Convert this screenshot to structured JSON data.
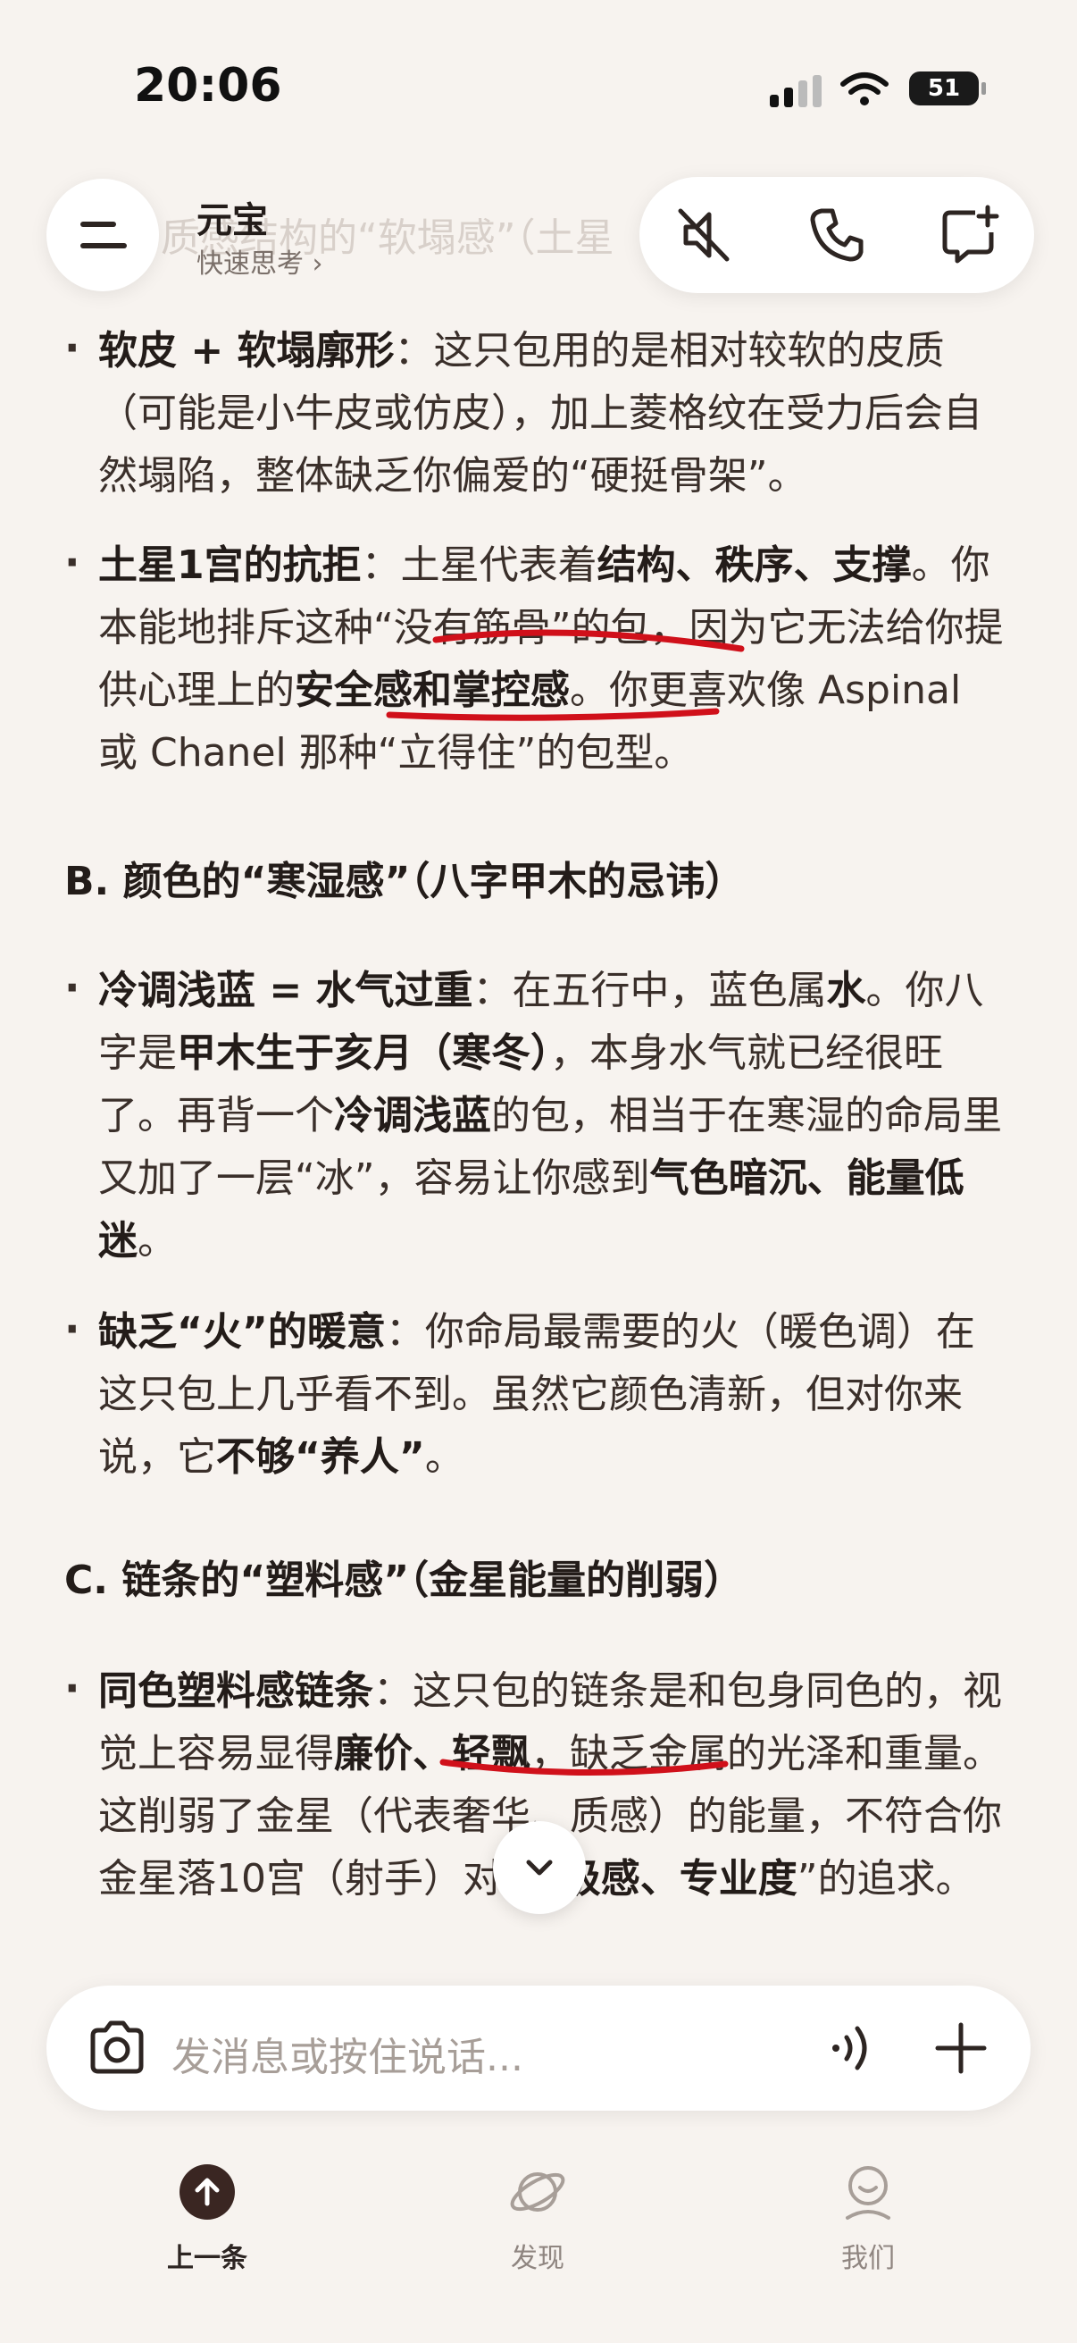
{
  "status": {
    "time": "20:06",
    "battery": "51"
  },
  "header": {
    "title": "元宝",
    "subtitle": "快速思考 ›",
    "faded_title": "质感结构的“软塌感”（土星",
    "menu_icon": "menu-icon",
    "actions": [
      "mute-speaker-icon",
      "phone-icon",
      "new-chat-icon"
    ]
  },
  "content": {
    "p1": {
      "bold": "软皮 + 软塌廓形",
      "text": "：这只包用的是相对较软的皮质（可能是小牛皮或仿皮），加上菱格纹在受力后会自然塌陷，整体缺乏你偏爱的“硬挺骨架”。"
    },
    "p2": {
      "bold": "土星1宫的抗拒",
      "t1": "：土星代表着",
      "b2": "结构、秩序、支撑",
      "t2": "。你本能地排斥这种“没有筋骨”的包，因为它无法给你提供心理上的",
      "b3": "安全感和掌控感",
      "t3": "。你更喜欢像 Aspinal 或 Chanel 那种“立得住”的包型。"
    },
    "heading_b": "B. 颜色的“寒湿感”（八字甲木的忌讳）",
    "p3": {
      "bold": "冷调浅蓝 = 水气过重",
      "t1": "：在五行中，蓝色属",
      "b2": "水",
      "t2": "。你八字是",
      "b3": "甲木生于亥月（寒冬）",
      "t3": "，本身水气就已经很旺了。再背一个",
      "b4": "冷调浅蓝",
      "t4": "的包，相当于在寒湿的命局里又加了一层“冰”，容易让你感到",
      "b5": "气色暗沉、能量低迷",
      "t5": "。"
    },
    "p4": {
      "bold": "缺乏“火”的暖意",
      "t1": "：你命局最需要的火（暖色调）在这只包上几乎看不到。虽然它颜色清新，但对你来说，它",
      "b2": "不够“养人”",
      "t2": "。"
    },
    "heading_c": "C. 链条的“塑料感”（金星能量的削弱）",
    "p5": {
      "bold": "同色塑料感链条",
      "t1": "：这只包的链条是和包身同色的，视觉上容易显得",
      "b2": "廉价、轻飘",
      "t2": "，缺乏金属的光泽和重量。这削弱了金星（代表奢华、质感）的能量，不符合你金星落10宫（射手）对“",
      "b3": "高级感、专业度",
      "t3": "”的追求。"
    }
  },
  "input": {
    "placeholder": "发消息或按住说话...",
    "camera_icon": "camera-icon",
    "voice_icon": "voice-wave-icon",
    "plus_icon": "plus-icon"
  },
  "tabs": [
    {
      "label": "上一条",
      "icon": "arrow-up-circle-icon"
    },
    {
      "label": "发现",
      "icon": "planet-icon"
    },
    {
      "label": "我们",
      "icon": "person-icon"
    }
  ],
  "colors": {
    "background": "#f7f3ef",
    "text": "#3a2f2a",
    "underline": "#d0101a"
  }
}
